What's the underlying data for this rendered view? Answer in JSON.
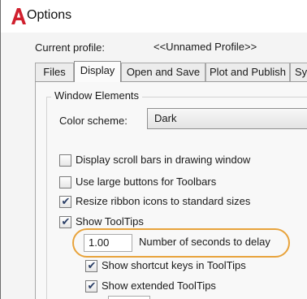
{
  "window": {
    "title": "Options",
    "logo_letter": "A"
  },
  "profile": {
    "label": "Current profile:",
    "value": "<<Unnamed Profile>>"
  },
  "tabs": [
    {
      "label": "Files",
      "active": false
    },
    {
      "label": "Display",
      "active": true
    },
    {
      "label": "Open and Save",
      "active": false
    },
    {
      "label": "Plot and Publish",
      "active": false
    },
    {
      "label": "Sy",
      "active": false
    }
  ],
  "window_elements": {
    "group_title": "Window Elements",
    "color_scheme_label": "Color scheme:",
    "color_scheme_value": "Dark"
  },
  "options": [
    {
      "label": "Display scroll bars in drawing window",
      "checked": false
    },
    {
      "label": "Use large buttons for Toolbars",
      "checked": false
    },
    {
      "label": "Resize ribbon icons to standard sizes",
      "checked": true
    },
    {
      "label": "Show ToolTips",
      "checked": true
    }
  ],
  "tooltip_delay": {
    "value": "1.00",
    "label": "Number of seconds to delay"
  },
  "sub_options": [
    {
      "label": "Show shortcut keys in ToolTips",
      "checked": true
    },
    {
      "label": "Show extended ToolTips",
      "checked": true
    }
  ],
  "colors": {
    "logo_red": "#d0202e",
    "highlight": "#e8a33b",
    "check": "#2a3e66"
  }
}
